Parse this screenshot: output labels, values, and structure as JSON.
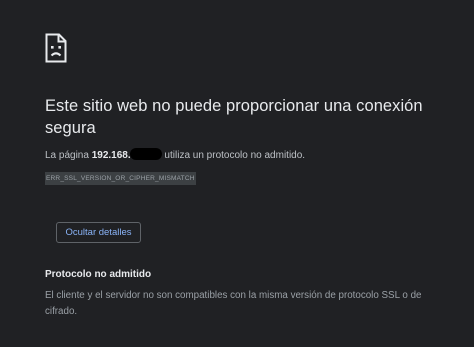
{
  "icon": "sad-page-icon",
  "heading": "Este sitio web no puede proporcionar una conexión segura",
  "message": {
    "prefix": "La página ",
    "host": "192.168.",
    "suffix": " utiliza un protocolo no admitido."
  },
  "error_code": "ERR_SSL_VERSION_OR_CIPHER_MISMATCH",
  "details_button_label": "Ocultar detalles",
  "details": {
    "heading": "Protocolo no admitido",
    "text": "El cliente y el servidor no son compatibles con la misma versión de protocolo SSL o de cifrado."
  },
  "colors": {
    "background": "#202124",
    "heading": "#e8eaed",
    "body_text": "#9aa0a6",
    "link_accent": "#8ab4f8",
    "error_code_bg": "#3c4043"
  }
}
